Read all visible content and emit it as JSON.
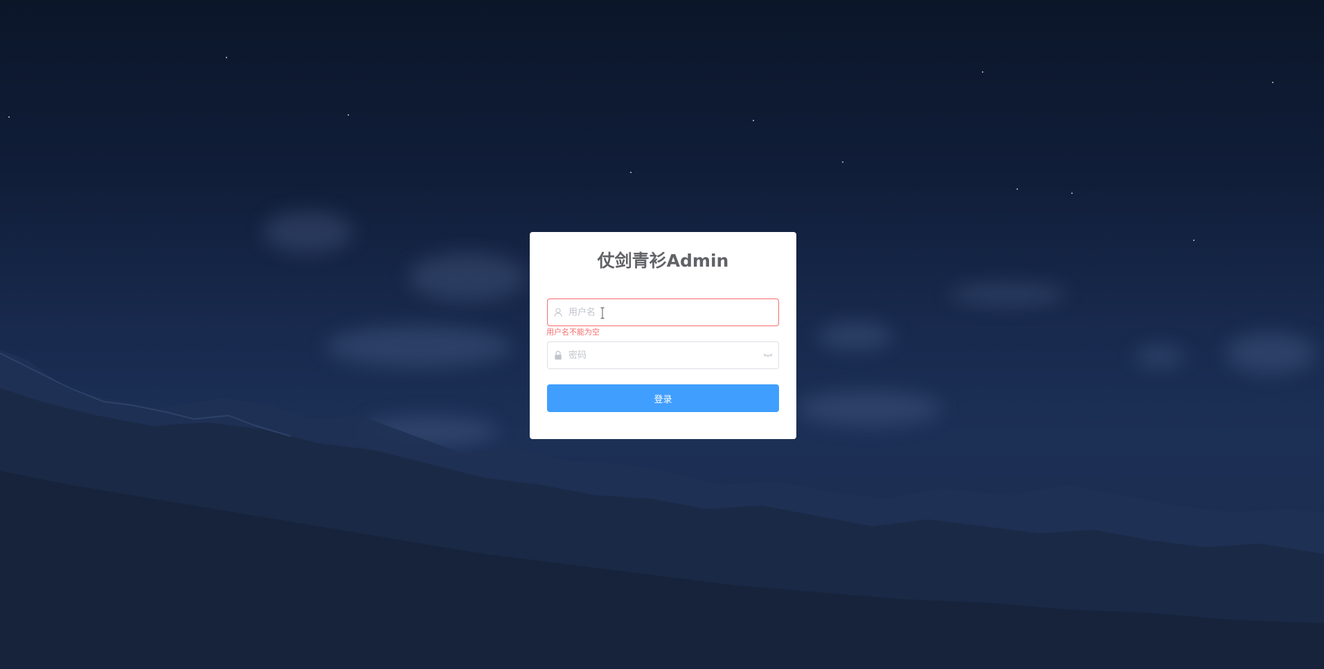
{
  "login": {
    "title": "仗剑青衫Admin",
    "username": {
      "placeholder": "用户名",
      "value": "",
      "icon": "user-icon",
      "error": "用户名不能为空"
    },
    "password": {
      "placeholder": "密码",
      "value": "",
      "icon": "lock-icon",
      "toggle_icon": "eye-closed-icon"
    },
    "submit_label": "登录"
  },
  "colors": {
    "primary": "#409eff",
    "error": "#f56c6c",
    "title": "#606266",
    "placeholder": "#c0c4cc",
    "border": "#dcdfe6",
    "background": "#15254a"
  }
}
